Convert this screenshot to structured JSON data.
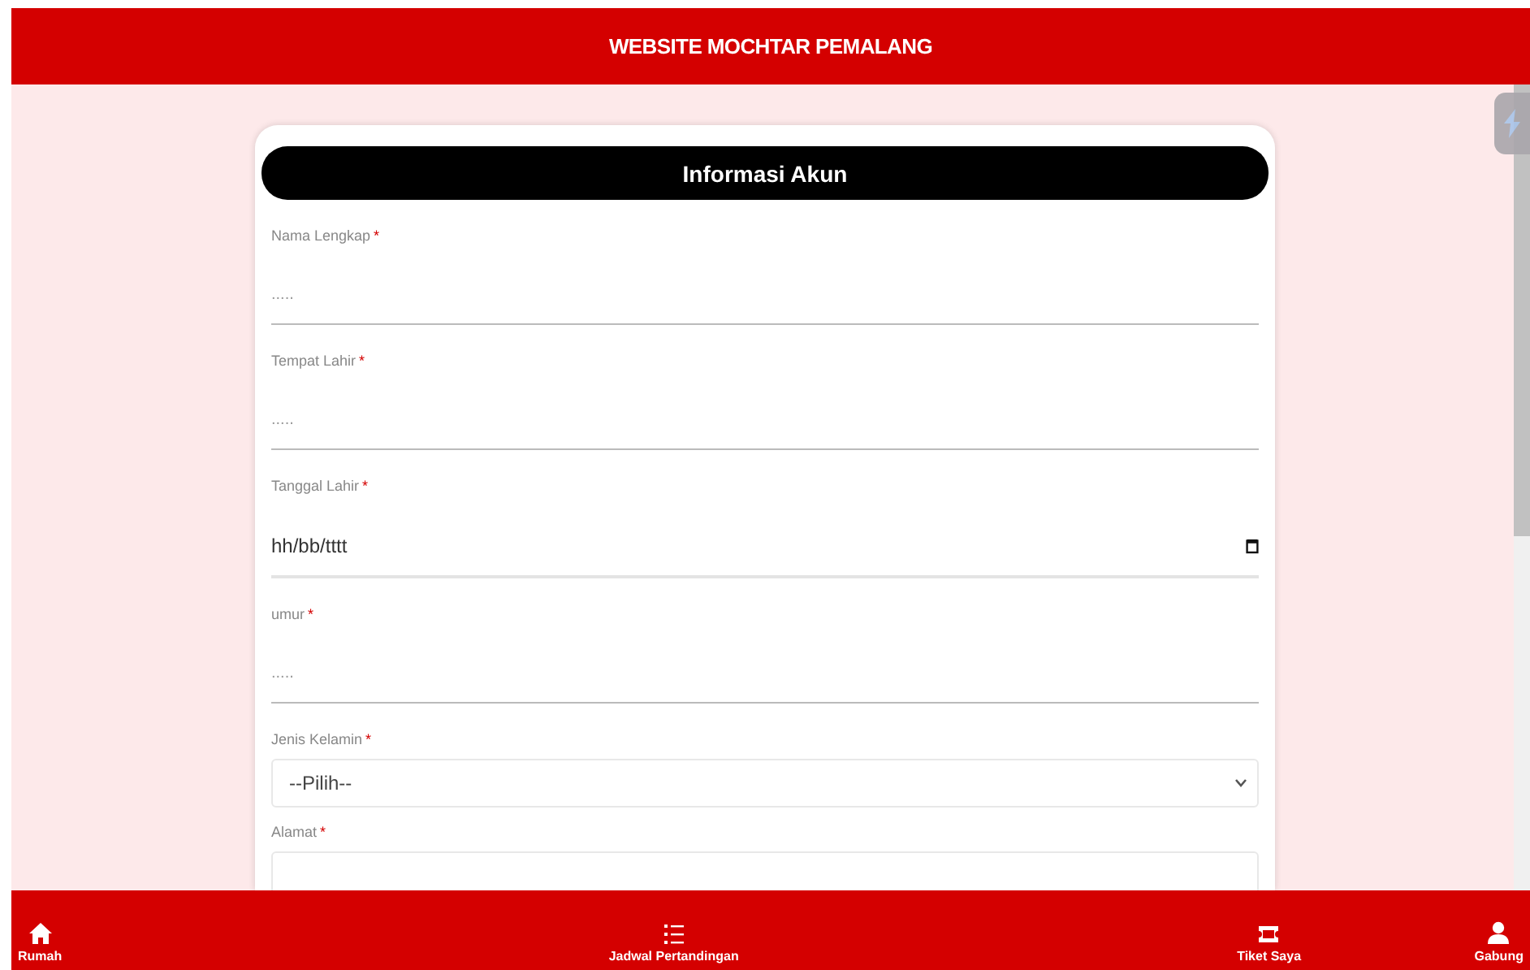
{
  "header": {
    "title": "WEBSITE MOCHTAR PEMALANG"
  },
  "card": {
    "title": "Informasi Akun",
    "fields": [
      {
        "kind": "text",
        "label": "Nama Lengkap",
        "required_mark": "*",
        "placeholder": "....."
      },
      {
        "kind": "text",
        "label": "Tempat Lahir",
        "required_mark": "*",
        "placeholder": "....."
      },
      {
        "kind": "date",
        "label": "Tanggal Lahir",
        "required_mark": "*",
        "value": "hh/bb/tttt"
      },
      {
        "kind": "text",
        "label": "umur",
        "required_mark": "*",
        "placeholder": "....."
      },
      {
        "kind": "select",
        "label": "Jenis Kelamin",
        "required_mark": "*",
        "value": "--Pilih--"
      },
      {
        "kind": "textarea",
        "label": "Alamat",
        "required_mark": "*"
      }
    ]
  },
  "nav": [
    {
      "kind": "home",
      "label": "Rumah"
    },
    {
      "kind": "list",
      "label": "Jadwal Pertandingan"
    },
    {
      "kind": "ticket",
      "label": "Tiket Saya"
    },
    {
      "kind": "user",
      "label": "Gabung"
    }
  ]
}
